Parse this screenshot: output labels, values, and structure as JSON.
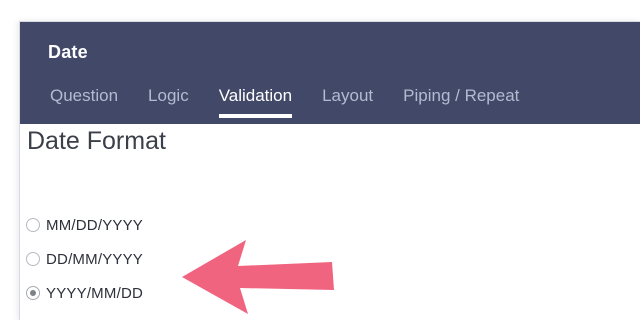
{
  "dialog": {
    "title": "Date",
    "tabs": [
      {
        "label": "Question",
        "active": false
      },
      {
        "label": "Logic",
        "active": false
      },
      {
        "label": "Validation",
        "active": true
      },
      {
        "label": "Layout",
        "active": false
      },
      {
        "label": "Piping / Repeat",
        "active": false
      }
    ],
    "header_color": "#414868"
  },
  "date_format": {
    "heading": "Date Format",
    "options": [
      {
        "label": "MM/DD/YYYY",
        "selected": false
      },
      {
        "label": "DD/MM/YYYY",
        "selected": false
      },
      {
        "label": "YYYY/MM/DD",
        "selected": true
      }
    ]
  },
  "annotation": {
    "icon": "arrow-left-icon",
    "color": "#f0647f"
  }
}
